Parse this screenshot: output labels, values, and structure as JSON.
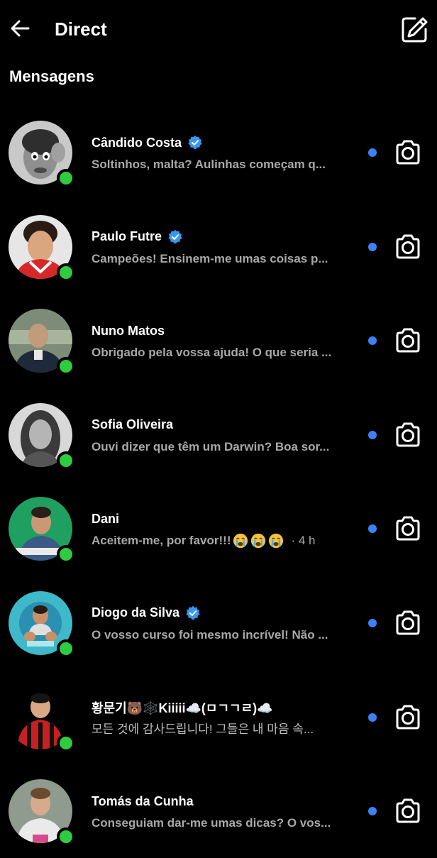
{
  "header": {
    "back_icon": "arrow-left-icon",
    "title": "Direct",
    "compose_icon": "compose-icon"
  },
  "section_title": "Mensagens",
  "conversations": [
    {
      "name": "Cândido Costa",
      "verified": true,
      "preview": "Soltinhos, malta? Aulinhas começam q...",
      "online": true,
      "unread": true,
      "avatar_color": "#bdbdbd"
    },
    {
      "name": "Paulo Futre",
      "verified": true,
      "preview": "Campeões! Ensinem-me umas coisas p...",
      "online": true,
      "unread": true,
      "avatar_color": "#d7d7d7"
    },
    {
      "name": "Nuno Matos",
      "verified": false,
      "preview": "Obrigado pela vossa ajuda! O que seria ...",
      "online": true,
      "unread": true,
      "avatar_color": "#6b7a6a"
    },
    {
      "name": "Sofia Oliveira",
      "verified": false,
      "preview": "Ouvi dizer que têm um Darwin? Boa sor...",
      "online": true,
      "unread": true,
      "avatar_color": "#bfbfbf"
    },
    {
      "name": "Dani",
      "verified": false,
      "preview": "Aceitem-me, por favor!!!",
      "preview_emojis": [
        "crying-face-emoji",
        "crying-face-emoji",
        "crying-face-emoji"
      ],
      "timestamp": "· 4 h",
      "online": true,
      "unread": true,
      "avatar_color": "#2aa86a"
    },
    {
      "name": "Diogo da Silva",
      "verified": true,
      "preview": "O vosso curso foi mesmo incrível! Não ...",
      "online": true,
      "unread": true,
      "avatar_color": "#3fb8c9"
    },
    {
      "name_parts": [
        "황문기",
        "🐻",
        "🕸️",
        "Kiiiii",
        "☁️",
        "(ㅁㄱㄱㄹ)",
        "☁️"
      ],
      "name": "황문기🐻🕸️Kiiiii☁️(ㅁㄱㄱㄹ)☁️",
      "verified": false,
      "preview": "모든 것에 감사드립니다! 그들은 내 마음 속...",
      "online": true,
      "unread": true,
      "avatar_color": "#b81f1f"
    },
    {
      "name": "Tomás da Cunha",
      "verified": false,
      "preview": "Conseguiam dar-me umas dicas? O vos...",
      "online": true,
      "unread": true,
      "avatar_color": "#8e9b8e"
    }
  ],
  "colors": {
    "background": "#000000",
    "text_primary": "#ffffff",
    "text_secondary": "#a8a8a8",
    "online": "#2ecc40",
    "unread": "#3b82f6",
    "verified": "#3897f0"
  },
  "row_icons": {
    "camera_icon": "camera-icon",
    "verified_icon": "verified-badge-icon"
  }
}
